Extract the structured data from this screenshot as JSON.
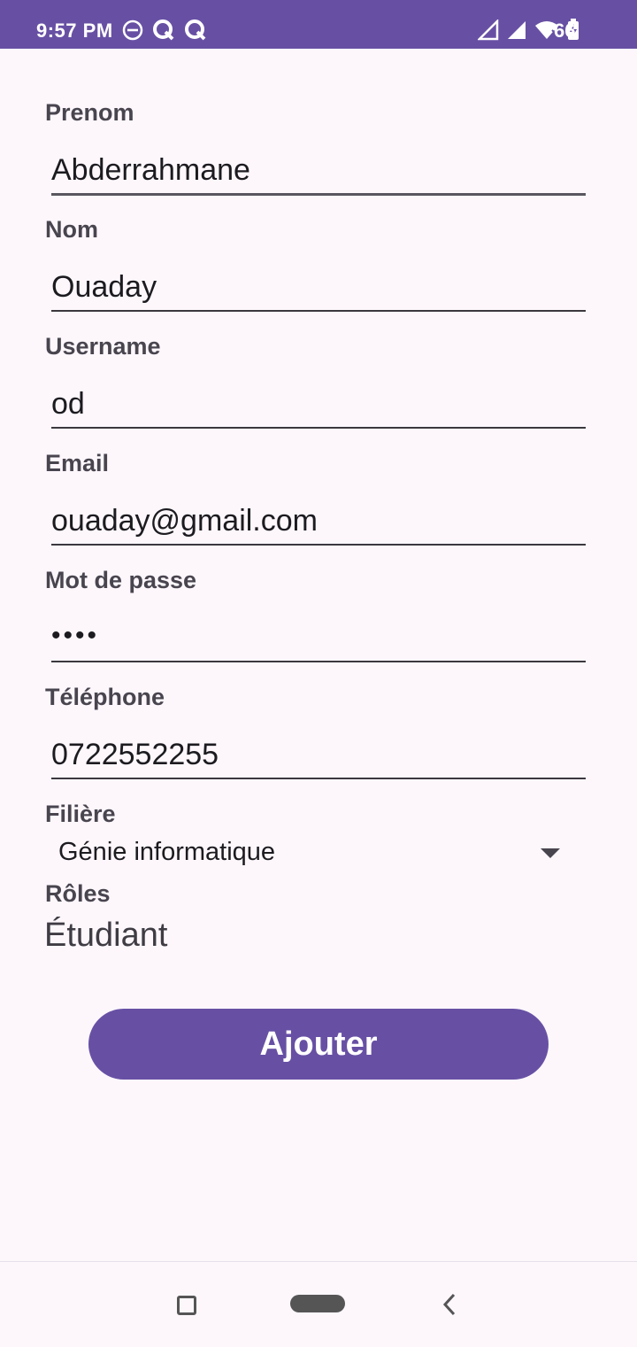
{
  "status_bar": {
    "time": "9:57 PM",
    "battery": "66",
    "icons": [
      "dnd-icon",
      "q-app-icon",
      "q-app-icon",
      "signal-icon",
      "signal-icon",
      "wifi-icon",
      "battery-charging-icon"
    ]
  },
  "form": {
    "prenom_label": "Prenom",
    "prenom_value": "Abderrahmane",
    "nom_label": "Nom",
    "nom_value": "Ouaday",
    "username_label": "Username",
    "username_value": "od",
    "email_label": "Email",
    "email_value": "ouaday@gmail.com",
    "password_label": "Mot de passe",
    "password_value": "••••",
    "phone_label": "Téléphone",
    "phone_value": "0722552255",
    "filiere_label": "Filière",
    "filiere_value": "Génie informatique",
    "roles_label": "Rôles",
    "roles_value": "Étudiant"
  },
  "actions": {
    "add_label": "Ajouter"
  },
  "colors": {
    "accent": "#6750a4",
    "background": "#fdf7fc",
    "label": "#49454f"
  }
}
